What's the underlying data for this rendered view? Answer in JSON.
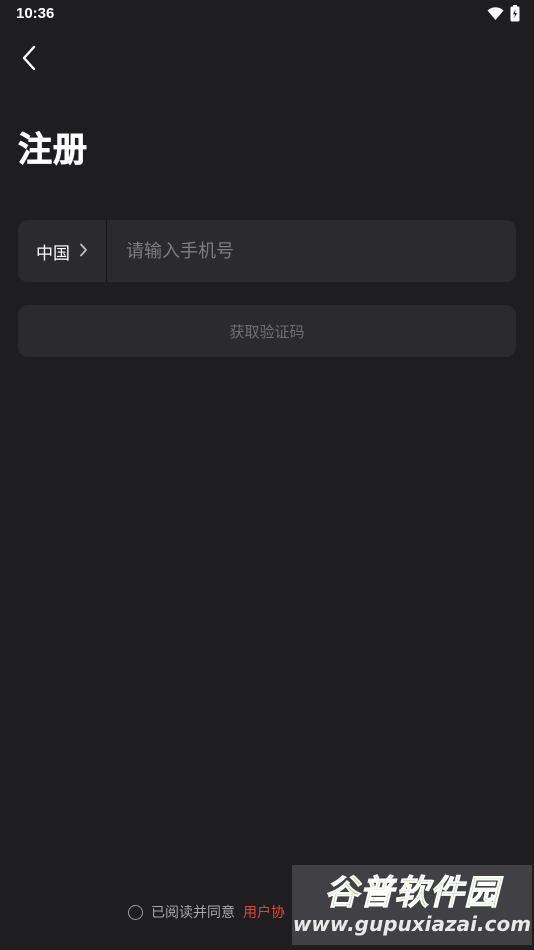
{
  "status_bar": {
    "time": "10:36",
    "icons": [
      "wifi-icon",
      "battery-icon"
    ]
  },
  "header": {
    "back_icon": "chevron-left-icon",
    "title": "注册"
  },
  "phone_form": {
    "country": "中国",
    "country_chevron": "chevron-right-icon",
    "phone_placeholder": "请输入手机号",
    "phone_value": ""
  },
  "actions": {
    "get_code_label": "获取验证码"
  },
  "agreement": {
    "text": "已阅读并同意",
    "link_text": "用户协"
  },
  "watermark": {
    "title": "谷普软件园",
    "url": "www.gupuxiazai.com"
  },
  "colors": {
    "background": "#1e1e20",
    "card": "#2b2b2e",
    "accent_link": "#e8442f",
    "watermark_green": "#7bd13d"
  }
}
